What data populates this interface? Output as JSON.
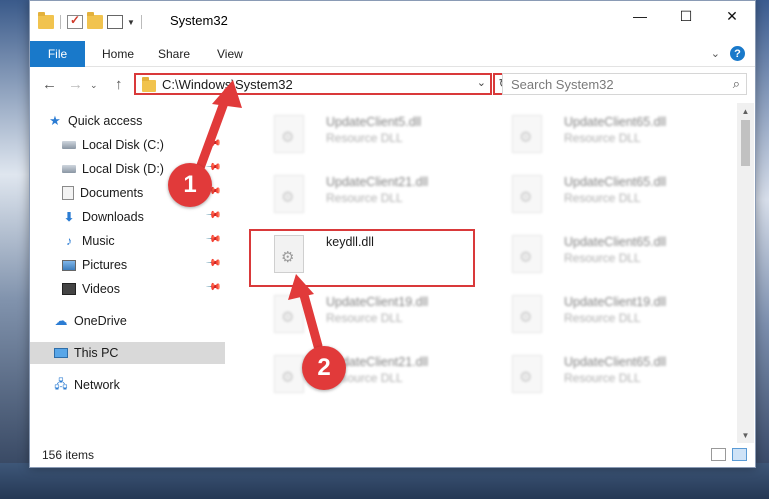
{
  "window": {
    "title": "System32"
  },
  "ribbon": {
    "tabs": [
      "File",
      "Home",
      "Share",
      "View"
    ]
  },
  "address_bar": {
    "path": "C:\\Windows\\System32"
  },
  "search": {
    "placeholder": "Search System32"
  },
  "sidebar": {
    "items": [
      {
        "label": "Quick access",
        "icon": "star-icon",
        "pinned": false
      },
      {
        "label": "Local Disk (C:)",
        "icon": "drive-icon",
        "pinned": true
      },
      {
        "label": "Local Disk (D:)",
        "icon": "drive-icon",
        "pinned": true
      },
      {
        "label": "Documents",
        "icon": "documents-icon",
        "pinned": true
      },
      {
        "label": "Downloads",
        "icon": "download-icon",
        "pinned": true
      },
      {
        "label": "Music",
        "icon": "music-icon",
        "pinned": true
      },
      {
        "label": "Pictures",
        "icon": "pictures-icon",
        "pinned": true
      },
      {
        "label": "Videos",
        "icon": "videos-icon",
        "pinned": true
      },
      {
        "label": "OneDrive",
        "icon": "cloud-icon",
        "pinned": false
      },
      {
        "label": "This PC",
        "icon": "computer-icon",
        "pinned": false,
        "selected": true
      },
      {
        "label": "Network",
        "icon": "network-icon",
        "pinned": false
      }
    ]
  },
  "files": [
    {
      "name": "UpdateClient5.dll",
      "type": "Resource DLL",
      "blurred": true
    },
    {
      "name": "UpdateClient65.dll",
      "type": "Resource DLL",
      "blurred": true
    },
    {
      "name": "UpdateClient21.dll",
      "type": "Resource DLL",
      "blurred": true
    },
    {
      "name": "UpdateClient65.dll",
      "type": "Resource DLL",
      "blurred": true
    },
    {
      "name": "keydll.dll",
      "type": "",
      "blurred": false,
      "highlighted": true
    },
    {
      "name": "UpdateClient65.dll",
      "type": "Resource DLL",
      "blurred": true
    },
    {
      "name": "UpdateClient19.dll",
      "type": "Resource DLL",
      "blurred": true
    },
    {
      "name": "UpdateClient19.dll",
      "type": "Resource DLL",
      "blurred": true
    },
    {
      "name": "UpdateClient21.dll",
      "type": "Resource DLL",
      "blurred": true
    },
    {
      "name": "UpdateClient65.dll",
      "type": "Resource DLL",
      "blurred": true
    }
  ],
  "status": {
    "item_count": "156 items"
  },
  "annotations": {
    "step1": "1",
    "step2": "2",
    "color": "#e13a3a"
  },
  "colors": {
    "accent": "#1979ca",
    "highlight_border": "#d9393a"
  }
}
